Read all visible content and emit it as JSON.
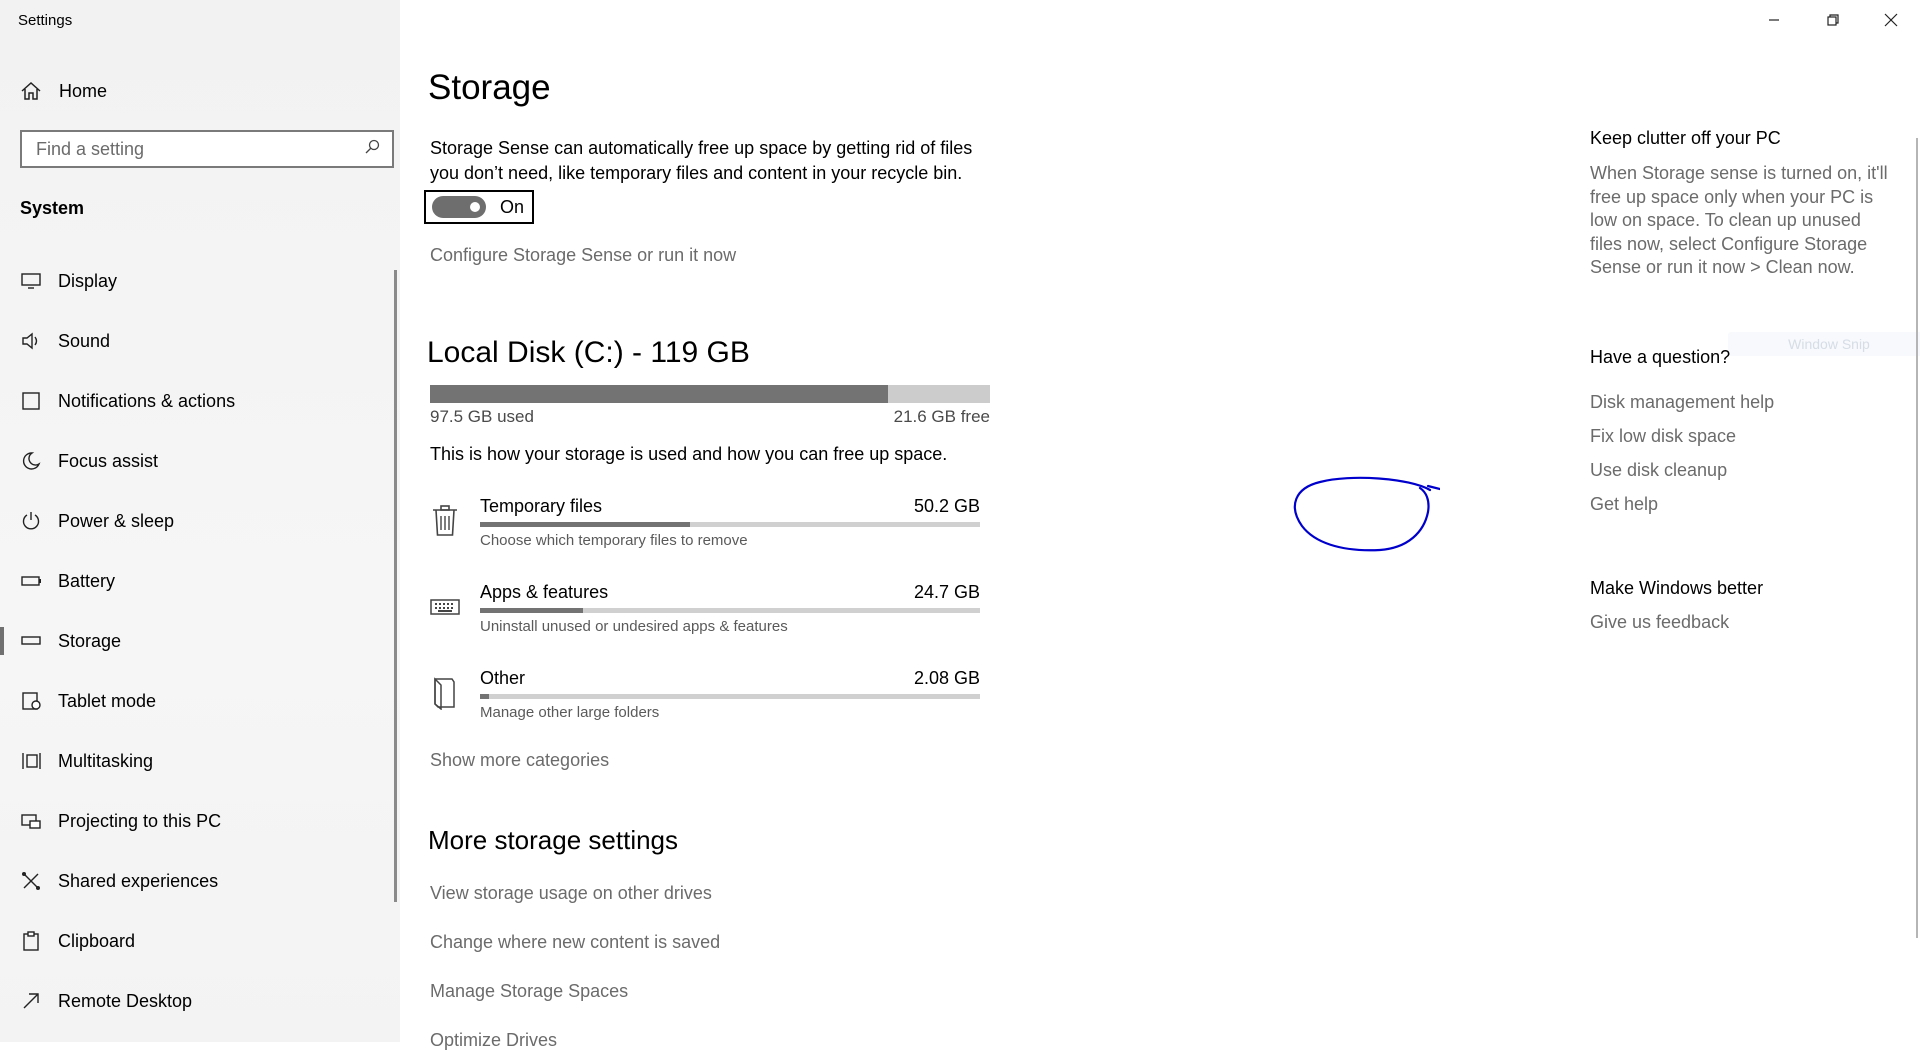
{
  "app": {
    "title": "Settings"
  },
  "sidebar": {
    "home_label": "Home",
    "search": {
      "placeholder": "Find a setting"
    },
    "section": "System",
    "items": [
      {
        "label": "Display",
        "icon": "monitor-icon"
      },
      {
        "label": "Sound",
        "icon": "speaker-icon"
      },
      {
        "label": "Notifications & actions",
        "icon": "notification-icon"
      },
      {
        "label": "Focus assist",
        "icon": "moon-icon"
      },
      {
        "label": "Power & sleep",
        "icon": "power-icon"
      },
      {
        "label": "Battery",
        "icon": "battery-icon"
      },
      {
        "label": "Storage",
        "icon": "storage-icon",
        "active": true
      },
      {
        "label": "Tablet mode",
        "icon": "tablet-icon"
      },
      {
        "label": "Multitasking",
        "icon": "multitasking-icon"
      },
      {
        "label": "Projecting to this PC",
        "icon": "projecting-icon"
      },
      {
        "label": "Shared experiences",
        "icon": "shared-icon"
      },
      {
        "label": "Clipboard",
        "icon": "clipboard-icon"
      },
      {
        "label": "Remote Desktop",
        "icon": "remote-desktop-icon"
      }
    ]
  },
  "main": {
    "title": "Storage",
    "description": "Storage Sense can automatically free up space by getting rid of files you don’t need, like temporary files and content in your recycle bin.",
    "toggle": {
      "state": "On",
      "on": true
    },
    "configure_link": "Configure Storage Sense or run it now",
    "disk": {
      "title": "Local Disk (C:) - 119 GB",
      "used": "97.5 GB used",
      "free": "21.6 GB free",
      "used_fraction": 0.8185
    },
    "info": "This is how your storage is used and how you can free up space.",
    "categories": [
      {
        "name": "Temporary files",
        "size": "50.2 GB",
        "sub": "Choose which temporary files to remove",
        "fraction": 0.42,
        "icon": "trash-icon"
      },
      {
        "name": "Apps & features",
        "size": "24.7 GB",
        "sub": "Uninstall unused or undesired apps & features",
        "fraction": 0.206,
        "icon": "keyboard-icon"
      },
      {
        "name": "Other",
        "size": "2.08 GB",
        "sub": "Manage other large folders",
        "fraction": 0.018,
        "icon": "folder-icon"
      }
    ],
    "show_more": "Show more categories",
    "more_title": "More storage settings",
    "more_links": [
      "View storage usage on other drives",
      "Change where new content is saved",
      "Manage Storage Spaces",
      "Optimize Drives"
    ],
    "ghost_label": "Window Snip"
  },
  "right": {
    "clutter_title": "Keep clutter off your PC",
    "clutter_body": "When Storage sense is turned on, it'll free up space only when your PC is low on space. To clean up unused files now, select Configure Storage Sense or run it now > Clean now.",
    "question_title": "Have a question?",
    "question_links": [
      "Disk management help",
      "Fix low disk space",
      "Use disk cleanup",
      "Get help"
    ],
    "better_title": "Make Windows better",
    "feedback_link": "Give us feedback"
  },
  "colors": {
    "accent": "#737373",
    "link": "#6b6b6b",
    "annotation": "#0000cc"
  }
}
